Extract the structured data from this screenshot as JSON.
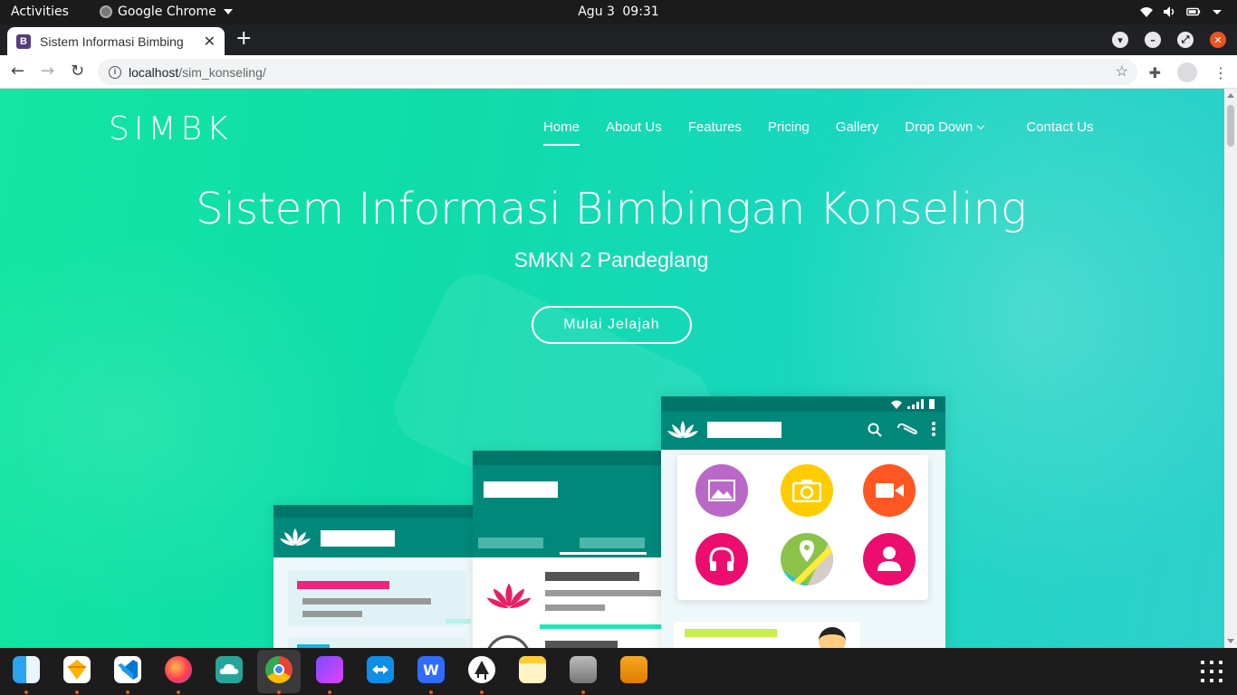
{
  "system_bar": {
    "activities": "Activities",
    "app_name": "Google Chrome",
    "date": "Agu 3",
    "time": "09:31"
  },
  "browser": {
    "tab_title": "Sistem Informasi Bimbing",
    "tab_favicon": "B",
    "url_host": "localhost",
    "url_path": "/sim_konseling/"
  },
  "site": {
    "brand": "SIMBK",
    "menu": {
      "home": "Home",
      "about": "About Us",
      "features": "Features",
      "pricing": "Pricing",
      "gallery": "Gallery",
      "dropdown": "Drop Down",
      "contact": "Contact Us"
    },
    "hero_title": "Sistem Informasi Bimbingan Konseling",
    "hero_subtitle": "SMKN 2 Pandeglang",
    "cta": "Mulai Jelajah"
  },
  "colors": {
    "accent_green": "#12e6a0",
    "mockup_teal": "#00897b",
    "ubuntu_orange": "#e95420"
  },
  "dock": {
    "apps": [
      "finder-icon",
      "sketch-icon",
      "vscode-icon",
      "firefox-icon",
      "cloud-icon",
      "chrome-icon",
      "screen-recorder-icon",
      "teamviewer-icon",
      "wps-icon",
      "inkscape-icon",
      "notes-icon",
      "disk-icon",
      "archive-icon"
    ]
  }
}
